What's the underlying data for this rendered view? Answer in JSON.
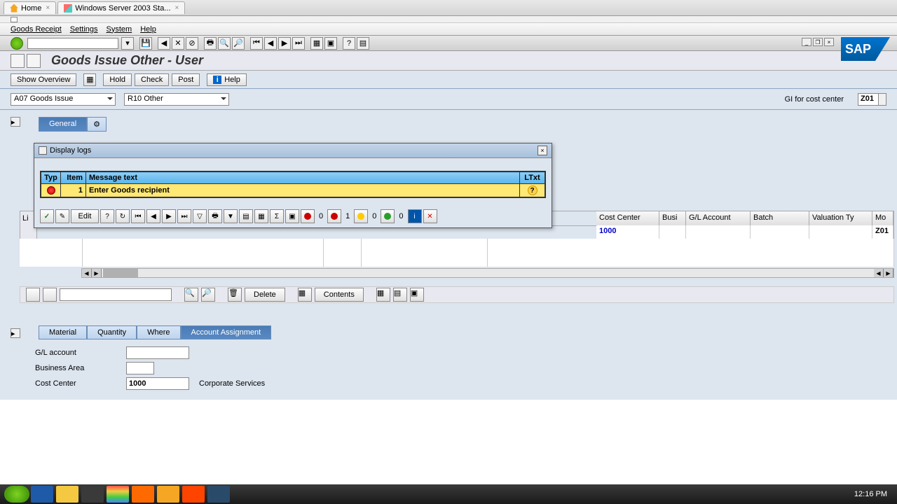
{
  "browser_tabs": {
    "home": "Home",
    "second": "Windows Server 2003 Sta..."
  },
  "sap_logo": "SAP",
  "menus": [
    "Goods Receipt",
    "Settings",
    "System",
    "Help"
  ],
  "page_title": "Goods Issue Other - User",
  "actions": {
    "show_overview": "Show Overview",
    "hold": "Hold",
    "check": "Check",
    "post": "Post",
    "help": "Help"
  },
  "selectors": {
    "action": "A07 Goods Issue",
    "ref": "R10 Other",
    "right_label": "GI for cost center",
    "right_value": "Z01"
  },
  "tabs_upper": {
    "general": "General"
  },
  "dialog": {
    "title": "Display logs",
    "headers": {
      "typ": "Typ",
      "item": "Item",
      "msg": "Message text",
      "ltxt": "LTxt"
    },
    "row": {
      "item": "1",
      "msg": "Enter Goods recipient"
    },
    "toolbar": {
      "edit": "Edit",
      "red_count": "0",
      "red_count2": "1",
      "yel_count": "0",
      "grn_count": "0"
    }
  },
  "grid": {
    "line_label": "Li",
    "headers": [
      "Cost Center",
      "Busi",
      "G/L Account",
      "Batch",
      "Valuation Ty",
      "Mo"
    ],
    "row": {
      "cost_center": "1000",
      "z_val": "Z01"
    }
  },
  "bottom_bar": {
    "delete": "Delete",
    "contents": "Contents"
  },
  "tabs_lower": [
    "Material",
    "Quantity",
    "Where",
    "Account Assignment"
  ],
  "form": {
    "gl_label": "G/L account",
    "gl_value": "",
    "ba_label": "Business Area",
    "ba_value": "",
    "cc_label": "Cost Center",
    "cc_value": "1000",
    "cc_desc": "Corporate Services"
  },
  "taskbar": {
    "clock": "12:16 PM"
  }
}
